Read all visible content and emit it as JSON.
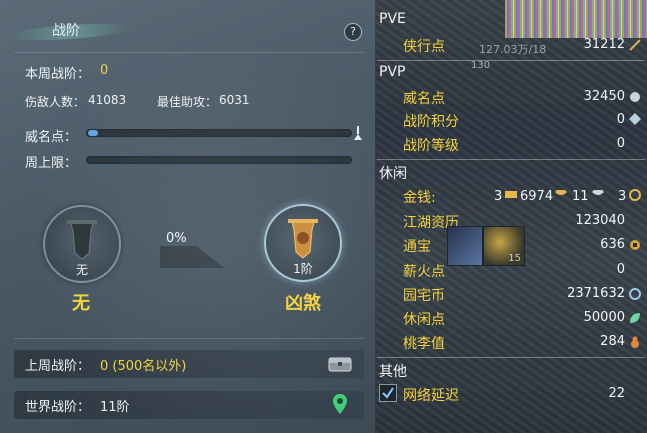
{
  "panel": {
    "title": "战阶",
    "help": "?",
    "weekly_rank_label": "本周战阶：",
    "weekly_rank_value": "0",
    "kills_label": "伤敌人数：",
    "kills_value": "41083",
    "assist_label": "最佳助攻：",
    "assist_value": "6031",
    "fame_label": "威名点：",
    "fame_progress": 0.04,
    "weekly_cap_label": "周上限：",
    "weekly_cap_progress": 0,
    "current_badge": {
      "sub": "无",
      "name": "无"
    },
    "progress_pct": "0%",
    "next_badge": {
      "sub": "1阶",
      "name": "凶煞"
    },
    "last_week_label": "上周战阶：",
    "last_week_value": "0 (500名以外)",
    "world_label": "世界战阶：",
    "world_value": "11阶"
  },
  "stats": {
    "pve_header": "PVE",
    "xia_label": "侠行点",
    "xia_value": "31212",
    "overlay_text": "127.03万/18",
    "overlay_num": "130",
    "pvp_header": "PVP",
    "wei_label": "威名点",
    "wei_value": "32450",
    "zj_score_label": "战阶积分",
    "zj_score_value": "0",
    "zj_level_label": "战阶等级",
    "zj_level_value": "0",
    "leisure_header": "休闲",
    "gold_label": "金钱:",
    "gold_a": "3",
    "gold_b": "6974",
    "gold_c": "11",
    "gold_d": "3",
    "jh_label": "江湖资历",
    "jh_value": "123040",
    "tb_label": "通宝",
    "tb_value": "636",
    "slot_num": "15",
    "xh_label": "薪火点",
    "xh_value": "0",
    "yz_label": "园宅币",
    "yz_value": "2371632",
    "xx_label": "休闲点",
    "xx_value": "50000",
    "tl_label": "桃李值",
    "tl_value": "284",
    "other_header": "其他",
    "net_label": "网络延迟",
    "net_value": "22"
  },
  "colors": {
    "accent_yellow": "#f4d23c",
    "bar_blue": "#5fa4e6"
  }
}
